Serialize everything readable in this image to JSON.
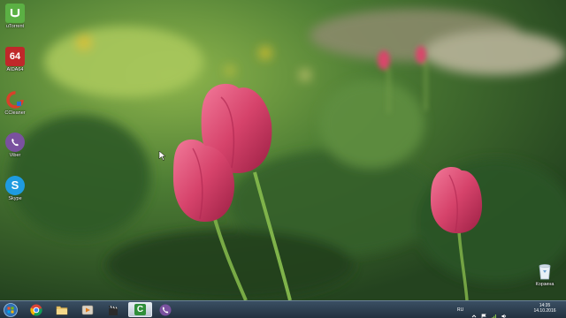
{
  "desktop": {
    "icons": [
      {
        "label": "uTorrent",
        "icon": "utorrent-icon",
        "color": "#5bb044"
      },
      {
        "label": "AIDA64",
        "icon": "aida64-icon",
        "color": "#c0282a",
        "badge": "64"
      },
      {
        "label": "CCleaner",
        "icon": "ccleaner-icon",
        "color": "#d9402a"
      },
      {
        "label": "Viber",
        "icon": "viber-icon",
        "color": "#7a519f"
      },
      {
        "label": "Skype",
        "icon": "skype-icon",
        "color": "#1e9be0",
        "badge": "S"
      }
    ],
    "recycle_bin": {
      "label": "Корзина",
      "icon": "recycle-bin-icon"
    }
  },
  "taskbar": {
    "start": {
      "icon": "windows-start-icon"
    },
    "pinned": [
      {
        "icon": "chrome-icon"
      },
      {
        "icon": "file-explorer-icon"
      },
      {
        "icon": "media-player-icon"
      },
      {
        "icon": "movie-maker-icon"
      },
      {
        "icon": "camtasia-icon",
        "active": true,
        "badge": "C"
      },
      {
        "icon": "viber-icon"
      }
    ],
    "tray": {
      "language": "RU",
      "time": "14:35",
      "date": "14.10.2016",
      "icons": [
        "show-hidden-icons-icon",
        "action-center-flag-icon",
        "network-icon",
        "volume-icon"
      ]
    }
  },
  "colors": {
    "taskbar_top": "#3a4f63",
    "taskbar_bottom": "#22313f",
    "tulip": "#d6436b",
    "foliage": "#3f6e2f"
  }
}
